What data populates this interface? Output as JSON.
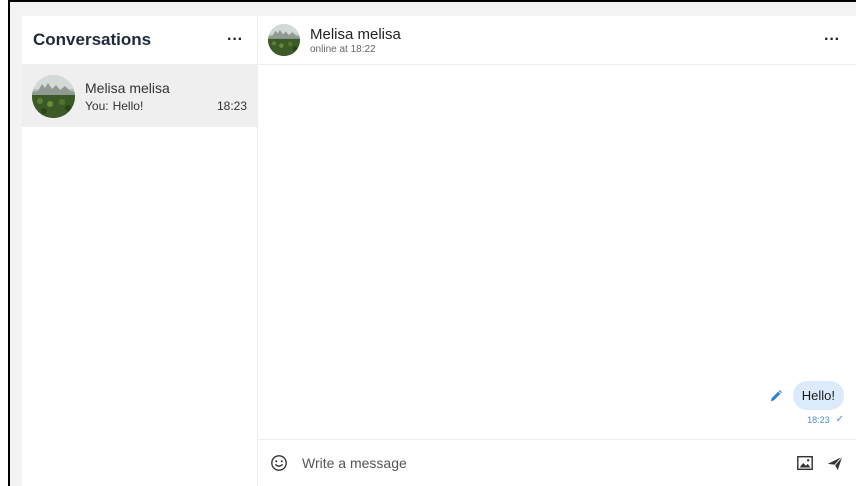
{
  "sidebar": {
    "title": "Conversations",
    "menu_label": "···",
    "conversations": [
      {
        "name": "Melisa melisa",
        "last_prefix": "You:",
        "last_message": "Hello!",
        "time": "18:23",
        "avatar": "landscape-photo"
      }
    ]
  },
  "chat": {
    "contact_name": "Melisa melisa",
    "status": "online at 18:22",
    "menu_label": "···",
    "messages": [
      {
        "text": "Hello!",
        "time": "18:23",
        "status": "sent",
        "direction": "outgoing"
      }
    ],
    "composer": {
      "placeholder": "Write a message"
    }
  },
  "icons": {
    "menu": "more-dots-icon",
    "edit": "pencil-icon",
    "emoji": "smiley-icon",
    "image": "image-icon",
    "send": "send-icon",
    "check": "check-icon"
  },
  "colors": {
    "bubble": "#dcebfb",
    "accent": "#4a90d9",
    "selected_conversation": "#efefef"
  }
}
